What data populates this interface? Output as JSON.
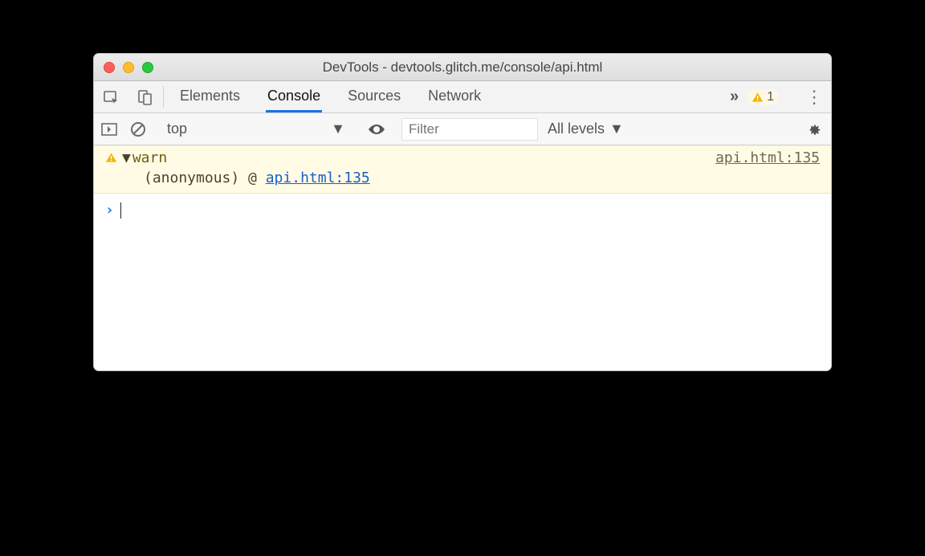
{
  "window": {
    "title": "DevTools - devtools.glitch.me/console/api.html"
  },
  "toolbar": {
    "tabs": [
      "Elements",
      "Console",
      "Sources",
      "Network"
    ],
    "active_tab": "Console",
    "warning_count": "1"
  },
  "filterbar": {
    "context": "top",
    "filter_placeholder": "Filter",
    "levels_label": "All levels"
  },
  "console": {
    "entry": {
      "message": "warn",
      "source": "api.html:135",
      "stack_prefix": "(anonymous) @ ",
      "stack_link": "api.html:135"
    }
  }
}
